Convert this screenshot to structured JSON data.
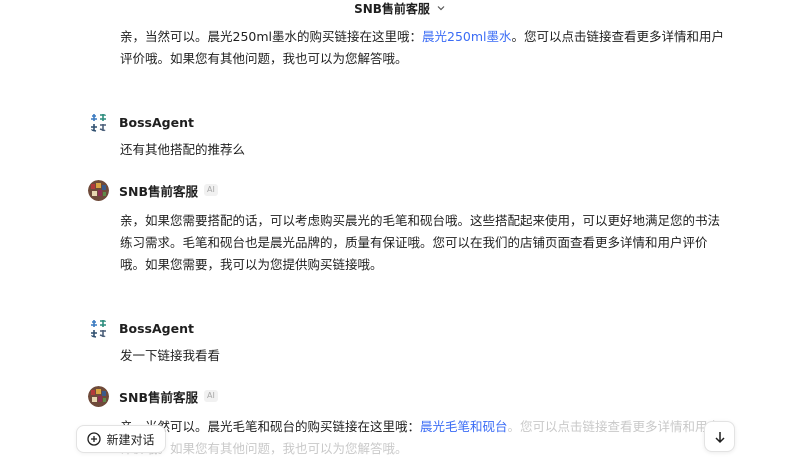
{
  "header": {
    "title": "SNB售前客服",
    "dropdown_icon": "chevron-down-icon"
  },
  "messages": [
    {
      "id": "bot1",
      "text_before": "亲，当然可以。晨光250ml墨水的购买链接在这里哦：",
      "link": "晨光250ml墨水",
      "text_after": "。您可以点击链接查看更多详情和用户评价哦。如果您有其他问题，我也可以为您解答哦。"
    },
    {
      "id": "user1",
      "sender": "BossAgent",
      "text": "还有其他搭配的推荐么"
    },
    {
      "id": "bot2",
      "sender": "SNB售前客服",
      "badge": "AI",
      "text": "亲，如果您需要搭配的话，可以考虑购买晨光的毛笔和砚台哦。这些搭配起来使用，可以更好地满足您的书法练习需求。毛笔和砚台也是晨光品牌的，质量有保证哦。您可以在我们的店铺页面查看更多详情和用户评价哦。如果您需要，我可以为您提供购买链接哦。"
    },
    {
      "id": "user2",
      "sender": "BossAgent",
      "text": "发一下链接我看看"
    },
    {
      "id": "bot3",
      "sender": "SNB售前客服",
      "badge": "AI",
      "text_before": "亲，当然可以。晨光毛笔和砚台的购买链接在这里哦：",
      "link": "晨光毛笔和砚台",
      "text_after": "。您可以点击链接查看更多详情和用户评价哦。如果您有其他问题，我也可以为您解答哦。"
    }
  ],
  "footer": {
    "new_chat_label": "新建对话",
    "new_chat_icon": "plus-circle-icon",
    "scroll_icon": "arrow-down-icon"
  },
  "colors": {
    "link": "#3b6cf5",
    "text": "#1f1f1f",
    "border": "#e3e3e3"
  }
}
